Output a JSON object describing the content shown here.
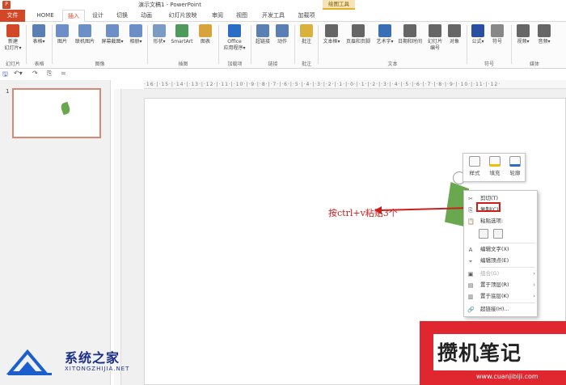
{
  "window": {
    "title": "演示文稿1 - PowerPoint",
    "context_group": "绘图工具"
  },
  "tabs": [
    {
      "label": "文件"
    },
    {
      "label": "HOME"
    },
    {
      "label": "插入"
    },
    {
      "label": "设计"
    },
    {
      "label": "切换"
    },
    {
      "label": "动画"
    },
    {
      "label": "幻灯片放映"
    },
    {
      "label": "审阅"
    },
    {
      "label": "视图"
    },
    {
      "label": "开发工具"
    },
    {
      "label": "加载项"
    },
    {
      "label": "格式"
    }
  ],
  "active_tab": "插入",
  "ribbon": {
    "buttons": [
      {
        "label": "新建\n幻灯片▾",
        "icon": "new-slide-icon",
        "color": "#d24726"
      },
      {
        "label": "表格▾",
        "icon": "table-icon",
        "color": "#5a7fb5"
      },
      {
        "label": "图片",
        "icon": "picture-icon",
        "color": "#6c8fc7"
      },
      {
        "label": "联机图片",
        "icon": "online-picture-icon",
        "color": "#6c8fc7"
      },
      {
        "label": "屏幕截图▾",
        "icon": "screenshot-icon",
        "color": "#6c8fc7"
      },
      {
        "label": "相册▾",
        "icon": "album-icon",
        "color": "#6c8fc7"
      },
      {
        "label": "形状▾",
        "icon": "shapes-icon",
        "color": "#7a9bc4"
      },
      {
        "label": "SmartArt",
        "icon": "smartart-icon",
        "color": "#4e9a5b"
      },
      {
        "label": "图表",
        "icon": "chart-icon",
        "color": "#d9a33b"
      },
      {
        "label": "Office\n应用程序▾",
        "icon": "office-apps-icon",
        "color": "#2b6cc4"
      },
      {
        "label": "超链接",
        "icon": "hyperlink-icon",
        "color": "#5a7fb5"
      },
      {
        "label": "动作",
        "icon": "action-icon",
        "color": "#5a7fb5"
      },
      {
        "label": "批注",
        "icon": "comment-icon",
        "color": "#d9b13b"
      },
      {
        "label": "文本框▾",
        "icon": "textbox-icon",
        "color": "#666"
      },
      {
        "label": "页眉和页脚",
        "icon": "header-footer-icon",
        "color": "#666"
      },
      {
        "label": "艺术字▾",
        "icon": "wordart-icon",
        "color": "#3b6fb5"
      },
      {
        "label": "日期和时间",
        "icon": "datetime-icon",
        "color": "#666"
      },
      {
        "label": "幻灯片\n编号",
        "icon": "slide-number-icon",
        "color": "#666"
      },
      {
        "label": "对象",
        "icon": "object-icon",
        "color": "#666"
      },
      {
        "label": "公式▾",
        "icon": "equation-icon",
        "color": "#2b4fa0"
      },
      {
        "label": "符号",
        "icon": "symbol-icon",
        "color": "#888"
      },
      {
        "label": "视频▾",
        "icon": "video-icon",
        "color": "#666"
      },
      {
        "label": "音频▾",
        "icon": "audio-icon",
        "color": "#666"
      }
    ],
    "groups": [
      {
        "label": "幻灯片"
      },
      {
        "label": "表格"
      },
      {
        "label": "图像"
      },
      {
        "label": "插图"
      },
      {
        "label": "加载项"
      },
      {
        "label": "链接"
      },
      {
        "label": "批注"
      },
      {
        "label": "文本"
      },
      {
        "label": "符号"
      },
      {
        "label": "媒体"
      }
    ]
  },
  "qat": {
    "items": [
      {
        "icon": "save-icon",
        "glyph": "🖫"
      },
      {
        "icon": "undo-icon",
        "glyph": "↶▾"
      },
      {
        "icon": "redo-icon",
        "glyph": "↷"
      },
      {
        "icon": "start-from-beginning-icon",
        "glyph": "⎘"
      },
      {
        "icon": "customize-qat-icon",
        "glyph": "="
      }
    ]
  },
  "slides_pane": {
    "slide_number": "1"
  },
  "ruler": {
    "text": "·16·|·15·|·14·|·13·|·12·|·11·|·10·|·9·|·8·|·7·|·6·|·5·|·4·|·3·|·2·|·1·|·0·|·1·|·2·|·3·|·4·|·5·|·6·|·7·|·8·|·9·|·10·|·11·|·12·"
  },
  "annotation": {
    "text": "按ctrl+v粘贴3个",
    "color": "#cc1e1e"
  },
  "mini_toolbar": {
    "buttons": [
      {
        "label": "样式",
        "icon": "style-icon"
      },
      {
        "label": "填充",
        "icon": "fill-icon"
      },
      {
        "label": "轮廓",
        "icon": "outline-icon"
      }
    ]
  },
  "context_menu": {
    "items": [
      {
        "label": "剪切(T)",
        "icon": "cut-icon",
        "glyph": "✂",
        "disabled": false
      },
      {
        "label": "复制(C)",
        "icon": "copy-icon",
        "glyph": "⎘",
        "disabled": false
      },
      {
        "label": "粘贴选项:",
        "icon": "paste-icon",
        "glyph": "📋",
        "disabled": false
      },
      {
        "label": "编辑文字(X)",
        "icon": "edit-text-icon",
        "glyph": "A",
        "disabled": false
      },
      {
        "label": "编辑顶点(E)",
        "icon": "edit-points-icon",
        "glyph": "⌖",
        "disabled": false
      },
      {
        "label": "组合(G)",
        "icon": "group-icon",
        "glyph": "▣",
        "disabled": true,
        "submenu": true
      },
      {
        "label": "置于顶层(R)",
        "icon": "bring-front-icon",
        "glyph": "▤",
        "disabled": false,
        "submenu": true
      },
      {
        "label": "置于底层(K)",
        "icon": "send-back-icon",
        "glyph": "▥",
        "disabled": false,
        "submenu": true
      },
      {
        "label": "超链接(H)...",
        "icon": "hyperlink-menu-icon",
        "glyph": "🔗",
        "disabled": false
      }
    ]
  },
  "watermarks": {
    "left": {
      "text": "系统之家",
      "sub": "XITONGZHIJIA.NET"
    },
    "right": {
      "text": "攒机笔记",
      "url": "www.cuanjibiji.com",
      "color": "#e0262f"
    }
  }
}
